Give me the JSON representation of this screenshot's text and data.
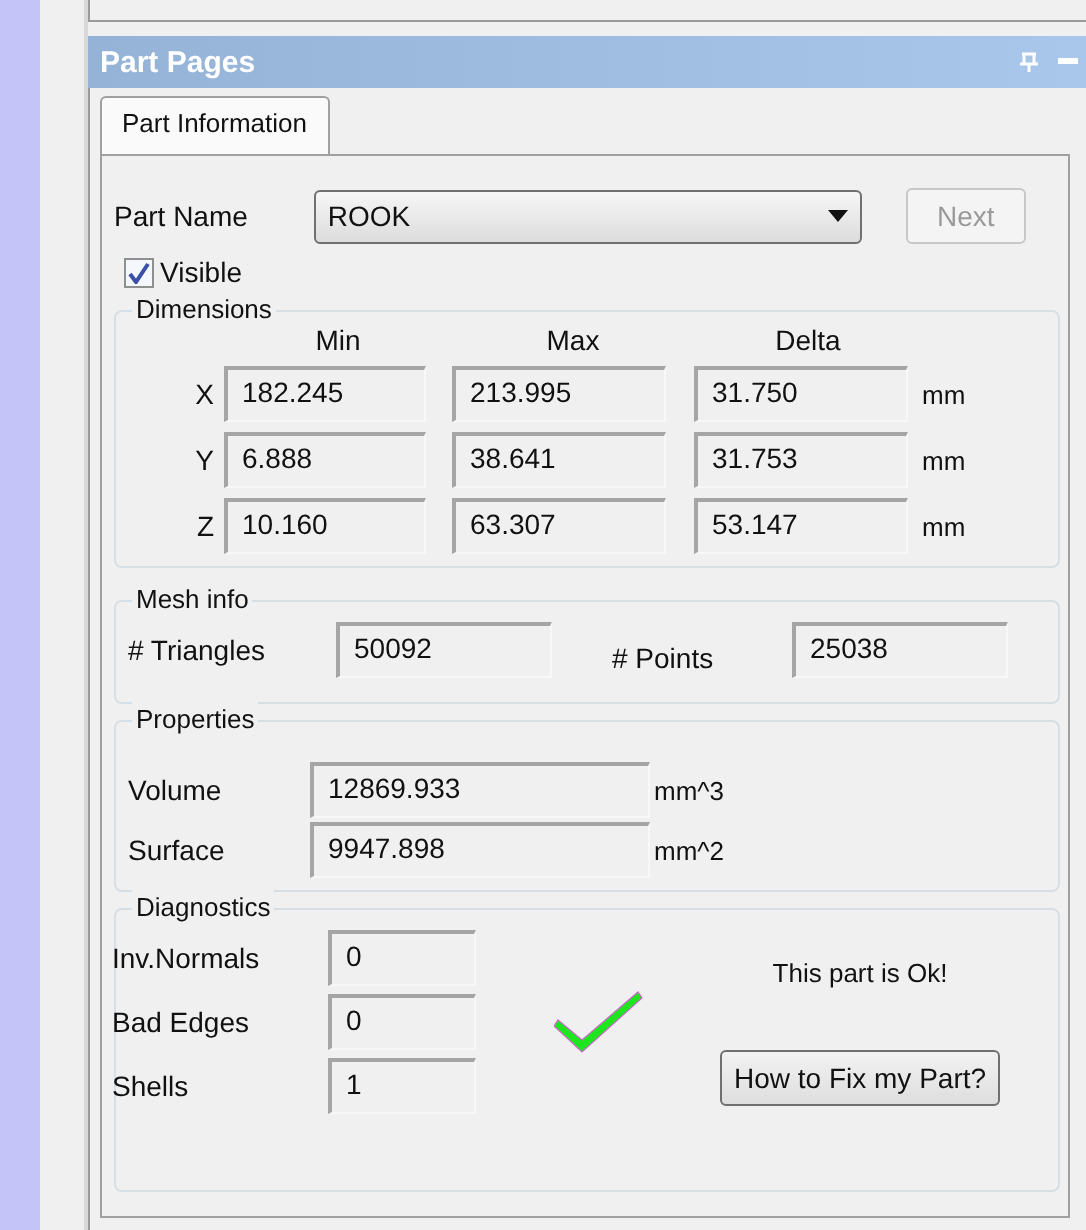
{
  "window": {
    "title": "Part Pages"
  },
  "tabs": [
    {
      "label": "Part Information",
      "selected": true
    }
  ],
  "part_name": {
    "label": "Part Name",
    "value": "ROOK"
  },
  "next_button": {
    "label": "Next",
    "disabled": true
  },
  "visible": {
    "label": "Visible",
    "checked": true
  },
  "dimensions": {
    "title": "Dimensions",
    "columns": [
      "Min",
      "Max",
      "Delta"
    ],
    "rows": [
      {
        "axis": "X",
        "min": "182.245",
        "max": "213.995",
        "delta": "31.750",
        "unit": "mm"
      },
      {
        "axis": "Y",
        "min": "6.888",
        "max": "38.641",
        "delta": "31.753",
        "unit": "mm"
      },
      {
        "axis": "Z",
        "min": "10.160",
        "max": "63.307",
        "delta": "53.147",
        "unit": "mm"
      }
    ]
  },
  "mesh_info": {
    "title": "Mesh info",
    "triangles_label": "# Triangles",
    "triangles": "50092",
    "points_label": "# Points",
    "points": "25038"
  },
  "properties": {
    "title": "Properties",
    "rows": [
      {
        "label": "Volume",
        "value": "12869.933",
        "unit": "mm^3"
      },
      {
        "label": "Surface",
        "value": "9947.898",
        "unit": "mm^2"
      }
    ]
  },
  "diagnostics": {
    "title": "Diagnostics",
    "rows": [
      {
        "label": "Inv.Normals",
        "value": "0"
      },
      {
        "label": "Bad Edges",
        "value": "0"
      },
      {
        "label": "Shells",
        "value": "1"
      }
    ],
    "part_ok": true,
    "message": "This part is Ok!",
    "fix_button": "How to Fix my Part?"
  }
}
